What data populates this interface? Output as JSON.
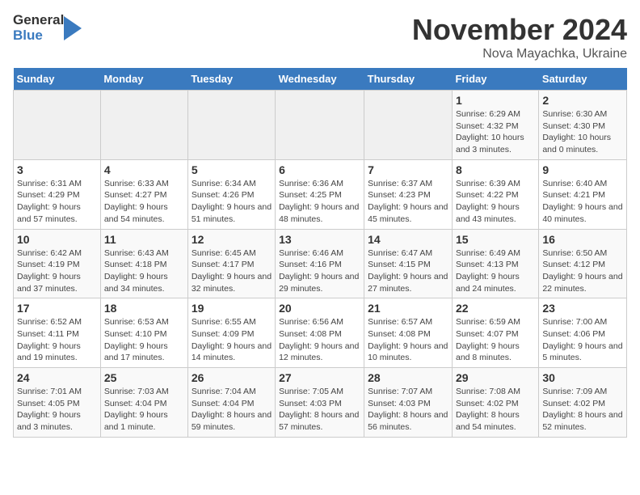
{
  "header": {
    "logo_general": "General",
    "logo_blue": "Blue",
    "title": "November 2024",
    "subtitle": "Nova Mayachka, Ukraine"
  },
  "weekdays": [
    "Sunday",
    "Monday",
    "Tuesday",
    "Wednesday",
    "Thursday",
    "Friday",
    "Saturday"
  ],
  "weeks": [
    [
      {
        "day": "",
        "detail": ""
      },
      {
        "day": "",
        "detail": ""
      },
      {
        "day": "",
        "detail": ""
      },
      {
        "day": "",
        "detail": ""
      },
      {
        "day": "",
        "detail": ""
      },
      {
        "day": "1",
        "detail": "Sunrise: 6:29 AM\nSunset: 4:32 PM\nDaylight: 10 hours and 3 minutes."
      },
      {
        "day": "2",
        "detail": "Sunrise: 6:30 AM\nSunset: 4:30 PM\nDaylight: 10 hours and 0 minutes."
      }
    ],
    [
      {
        "day": "3",
        "detail": "Sunrise: 6:31 AM\nSunset: 4:29 PM\nDaylight: 9 hours and 57 minutes."
      },
      {
        "day": "4",
        "detail": "Sunrise: 6:33 AM\nSunset: 4:27 PM\nDaylight: 9 hours and 54 minutes."
      },
      {
        "day": "5",
        "detail": "Sunrise: 6:34 AM\nSunset: 4:26 PM\nDaylight: 9 hours and 51 minutes."
      },
      {
        "day": "6",
        "detail": "Sunrise: 6:36 AM\nSunset: 4:25 PM\nDaylight: 9 hours and 48 minutes."
      },
      {
        "day": "7",
        "detail": "Sunrise: 6:37 AM\nSunset: 4:23 PM\nDaylight: 9 hours and 45 minutes."
      },
      {
        "day": "8",
        "detail": "Sunrise: 6:39 AM\nSunset: 4:22 PM\nDaylight: 9 hours and 43 minutes."
      },
      {
        "day": "9",
        "detail": "Sunrise: 6:40 AM\nSunset: 4:21 PM\nDaylight: 9 hours and 40 minutes."
      }
    ],
    [
      {
        "day": "10",
        "detail": "Sunrise: 6:42 AM\nSunset: 4:19 PM\nDaylight: 9 hours and 37 minutes."
      },
      {
        "day": "11",
        "detail": "Sunrise: 6:43 AM\nSunset: 4:18 PM\nDaylight: 9 hours and 34 minutes."
      },
      {
        "day": "12",
        "detail": "Sunrise: 6:45 AM\nSunset: 4:17 PM\nDaylight: 9 hours and 32 minutes."
      },
      {
        "day": "13",
        "detail": "Sunrise: 6:46 AM\nSunset: 4:16 PM\nDaylight: 9 hours and 29 minutes."
      },
      {
        "day": "14",
        "detail": "Sunrise: 6:47 AM\nSunset: 4:15 PM\nDaylight: 9 hours and 27 minutes."
      },
      {
        "day": "15",
        "detail": "Sunrise: 6:49 AM\nSunset: 4:13 PM\nDaylight: 9 hours and 24 minutes."
      },
      {
        "day": "16",
        "detail": "Sunrise: 6:50 AM\nSunset: 4:12 PM\nDaylight: 9 hours and 22 minutes."
      }
    ],
    [
      {
        "day": "17",
        "detail": "Sunrise: 6:52 AM\nSunset: 4:11 PM\nDaylight: 9 hours and 19 minutes."
      },
      {
        "day": "18",
        "detail": "Sunrise: 6:53 AM\nSunset: 4:10 PM\nDaylight: 9 hours and 17 minutes."
      },
      {
        "day": "19",
        "detail": "Sunrise: 6:55 AM\nSunset: 4:09 PM\nDaylight: 9 hours and 14 minutes."
      },
      {
        "day": "20",
        "detail": "Sunrise: 6:56 AM\nSunset: 4:08 PM\nDaylight: 9 hours and 12 minutes."
      },
      {
        "day": "21",
        "detail": "Sunrise: 6:57 AM\nSunset: 4:08 PM\nDaylight: 9 hours and 10 minutes."
      },
      {
        "day": "22",
        "detail": "Sunrise: 6:59 AM\nSunset: 4:07 PM\nDaylight: 9 hours and 8 minutes."
      },
      {
        "day": "23",
        "detail": "Sunrise: 7:00 AM\nSunset: 4:06 PM\nDaylight: 9 hours and 5 minutes."
      }
    ],
    [
      {
        "day": "24",
        "detail": "Sunrise: 7:01 AM\nSunset: 4:05 PM\nDaylight: 9 hours and 3 minutes."
      },
      {
        "day": "25",
        "detail": "Sunrise: 7:03 AM\nSunset: 4:04 PM\nDaylight: 9 hours and 1 minute."
      },
      {
        "day": "26",
        "detail": "Sunrise: 7:04 AM\nSunset: 4:04 PM\nDaylight: 8 hours and 59 minutes."
      },
      {
        "day": "27",
        "detail": "Sunrise: 7:05 AM\nSunset: 4:03 PM\nDaylight: 8 hours and 57 minutes."
      },
      {
        "day": "28",
        "detail": "Sunrise: 7:07 AM\nSunset: 4:03 PM\nDaylight: 8 hours and 56 minutes."
      },
      {
        "day": "29",
        "detail": "Sunrise: 7:08 AM\nSunset: 4:02 PM\nDaylight: 8 hours and 54 minutes."
      },
      {
        "day": "30",
        "detail": "Sunrise: 7:09 AM\nSunset: 4:02 PM\nDaylight: 8 hours and 52 minutes."
      }
    ]
  ]
}
